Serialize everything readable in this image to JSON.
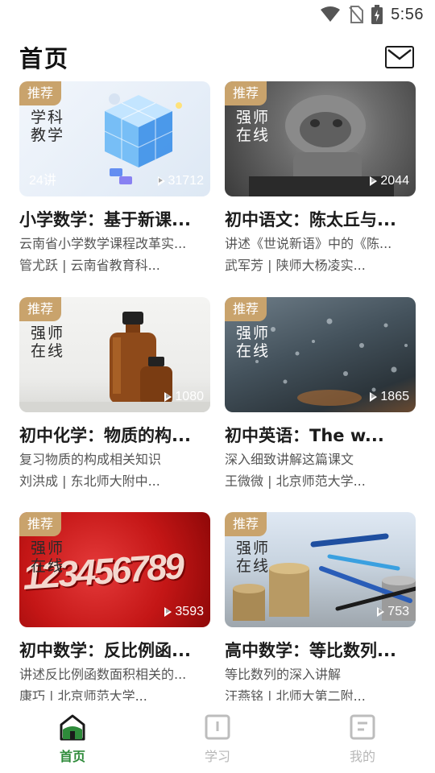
{
  "status_bar": {
    "time": "5:56"
  },
  "header": {
    "title": "首页"
  },
  "cards": [
    {
      "badge": "推荐",
      "brand": "学科\n教学",
      "lessons": "24讲",
      "plays": "31712",
      "title": "小学数学：基于新课...",
      "desc": "云南省小学数学课程改革实...",
      "meta": "管尤跃 | 云南省教育科..."
    },
    {
      "badge": "推荐",
      "brand": "强师\n在线",
      "lessons": "",
      "plays": "2044",
      "title": "初中语文：陈太丘与...",
      "desc": "讲述《世说新语》中的《陈...",
      "meta": "武军芳 | 陕师大杨凌实..."
    },
    {
      "badge": "推荐",
      "brand": "强师\n在线",
      "lessons": "",
      "plays": "1080",
      "title": "初中化学：物质的构...",
      "desc": "复习物质的构成相关知识",
      "meta": "刘洪成 | 东北师大附中..."
    },
    {
      "badge": "推荐",
      "brand": "强师\n在线",
      "lessons": "",
      "plays": "1865",
      "title": "初中英语：The w...",
      "desc": "深入细致讲解这篇课文",
      "meta": "王微微 | 北京师范大学..."
    },
    {
      "badge": "推荐",
      "brand": "强师\n在线",
      "lessons": "",
      "plays": "3593",
      "title": "初中数学：反比例函...",
      "desc": "讲述反比例函数面积相关的...",
      "meta": "康巧 | 北京师范大学..."
    },
    {
      "badge": "推荐",
      "brand": "强师\n在线",
      "lessons": "",
      "plays": "753",
      "title": "高中数学：等比数列...",
      "desc": "等比数列的深入讲解",
      "meta": "汪燕铭 | 北师大第二附..."
    }
  ],
  "thumb_number_art": "123456789",
  "bottom_nav": {
    "items": [
      {
        "label": "首页",
        "icon": "home-icon",
        "active": true
      },
      {
        "label": "学习",
        "icon": "study-icon",
        "active": false
      },
      {
        "label": "我的",
        "icon": "profile-icon",
        "active": false
      }
    ]
  },
  "colors": {
    "accent": "#2e8b3a",
    "badge": "#c9a36c",
    "inactive": "#b7b7b7"
  }
}
